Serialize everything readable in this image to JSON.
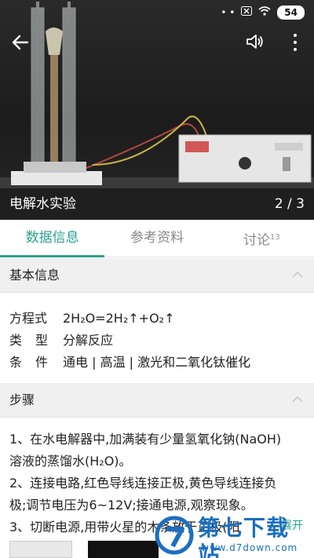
{
  "status_bar": {
    "dots": "• •",
    "sim_icon": "x-box-icon",
    "wifi_icon": "wifi-icon",
    "battery": "54"
  },
  "media": {
    "title": "电解水实验",
    "counter": "2 / 3",
    "back_icon": "arrow-left-icon",
    "sound_icon": "speaker-icon",
    "more_icon": "more-vertical-icon"
  },
  "tabs": [
    {
      "label": "数据信息",
      "active": true
    },
    {
      "label": "参考资料",
      "active": false
    },
    {
      "label": "讨论",
      "badge": "13",
      "active": false
    }
  ],
  "basic_info": {
    "header": "基本信息",
    "rows": [
      {
        "key": "方程式",
        "value": "2H₂O=2H₂↑+O₂↑"
      },
      {
        "key": "类型",
        "value": "分解反应"
      },
      {
        "key": "条件",
        "value": "通电 | 高温 | 激光和二氧化钛催化"
      }
    ]
  },
  "steps": {
    "header": "步骤",
    "lines": [
      "1、在水电解器中,加满装有少量氢氧化钠(NaOH)",
      "溶液的蒸馏水(H₂O)。",
      "2、连接电路,红色导线连接正极,黄色导线连接负",
      "极;调节电压为6~12V;接通电源,观察现象。",
      "3、切断电源,用带火星的木条放于正极(阳"
    ],
    "expand_label": "展开"
  },
  "watermark": {
    "title": "第七下载站",
    "url": "www.d7down.com"
  },
  "colors": {
    "accent": "#2aa18f",
    "watermark": "#1b6fc2"
  }
}
